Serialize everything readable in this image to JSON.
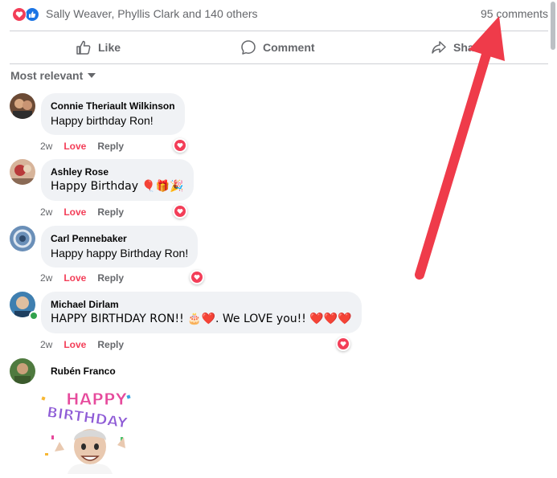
{
  "reactions": {
    "summary": "Sally Weaver, Phyllis Clark and 140 others",
    "icons": [
      "love-icon",
      "like-icon"
    ]
  },
  "comments_count": "95 comments",
  "actions": {
    "like": "Like",
    "comment": "Comment",
    "share": "Sha"
  },
  "sort": {
    "label": "Most relevant"
  },
  "comments": [
    {
      "name": "Connie Theriault Wilkinson",
      "text": "Happy birthday Ron!",
      "time": "2w",
      "love": "Love",
      "reply": "Reply"
    },
    {
      "name": "Ashley Rose",
      "text": "Happy Birthday 🎈🎁🎉",
      "time": "2w",
      "love": "Love",
      "reply": "Reply"
    },
    {
      "name": "Carl Pennebaker",
      "text": "Happy happy Birthday Ron!",
      "time": "2w",
      "love": "Love",
      "reply": "Reply"
    },
    {
      "name": "Michael Dirlam",
      "text": "HAPPY BIRTHDAY RON!! 🎂❤️. We LOVE you!! ❤️❤️❤️",
      "time": "2w",
      "love": "Love",
      "reply": "Reply"
    },
    {
      "name": "Rubén Franco",
      "sticker": {
        "line1": "HAPPY",
        "line2": "BIRTHDAY"
      }
    }
  ],
  "colors": {
    "love": "#f33e58",
    "like": "#1b74e4",
    "arrow": "#ef3b4a",
    "secondary_text": "#65676b",
    "bubble": "#f0f2f5"
  }
}
